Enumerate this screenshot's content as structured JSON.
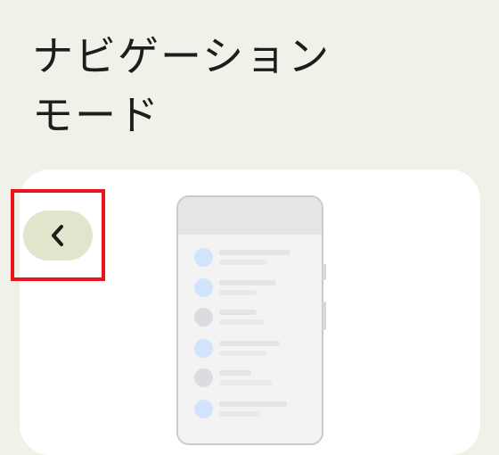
{
  "page": {
    "title_line1": "ナビゲーション",
    "title_line2": "モード"
  },
  "back_button": {
    "icon": "chevron-left-icon"
  },
  "illustration": {
    "rows": [
      {
        "dot_color": "#d2e3fc"
      },
      {
        "dot_color": "#d2e3fc"
      },
      {
        "dot_color": "#dadce0"
      },
      {
        "dot_color": "#d2e3fc"
      },
      {
        "dot_color": "#dadce0"
      },
      {
        "dot_color": "#d2e3fc"
      }
    ]
  },
  "colors": {
    "background": "#f0f1e8",
    "card": "#ffffff",
    "back_button_bg": "#dfe6cc",
    "highlight": "#e8151b"
  }
}
